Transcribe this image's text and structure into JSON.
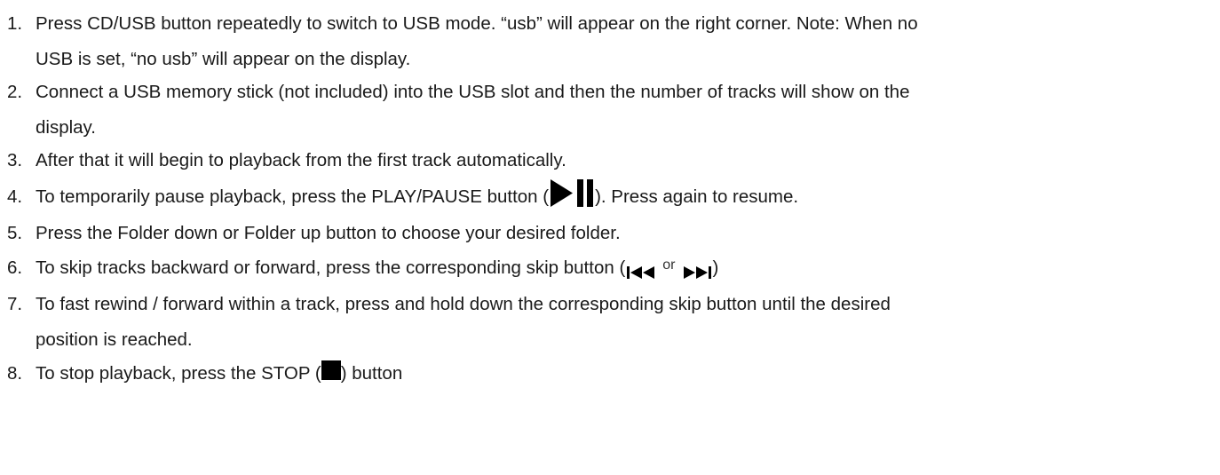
{
  "steps": [
    {
      "number": "1.",
      "line1": "Press CD/USB button repeatedly to switch to USB mode. “usb” will appear on the right corner. Note: When no",
      "line2": "USB is set, “no usb” will appear on the display."
    },
    {
      "number": "2.",
      "line1": "Connect a USB memory stick (not included) into the USB slot and then the number of tracks will show on the",
      "line2": "display."
    },
    {
      "number": "3.",
      "line1": "After that it will begin to playback from the first track automatically."
    },
    {
      "number": "4.",
      "before_icon": "To temporarily pause playback, press the PLAY/PAUSE button (",
      "icon": "play-pause-icon",
      "after_icon": "). Press again to resume."
    },
    {
      "number": "5.",
      "line1": "Press the Folder down or Folder up button to choose your desired folder."
    },
    {
      "number": "6.",
      "before_icon": "To skip tracks backward or forward, press the corresponding skip button (",
      "icon_back": "skip-back-icon",
      "or_text": "or",
      "icon_forward": "skip-forward-icon",
      "after_icon": ")"
    },
    {
      "number": "7.",
      "line1": "To fast rewind / forward within a track, press and hold down the corresponding skip button until the desired",
      "line2": "position is reached."
    },
    {
      "number": "8.",
      "before_icon": "To stop playback, press the STOP (",
      "icon": "stop-icon",
      "after_icon": ") button"
    }
  ],
  "colors": {
    "text": "#1a1a1a",
    "icon": "#000000",
    "background": "#ffffff"
  }
}
